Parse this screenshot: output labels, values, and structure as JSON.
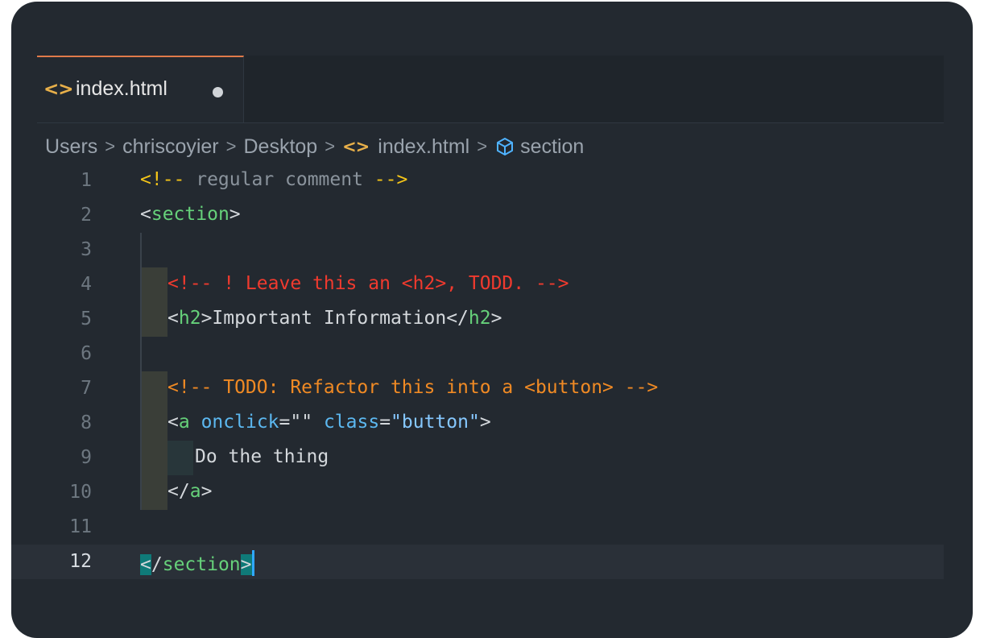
{
  "tab": {
    "icon": "html-brackets-icon",
    "label": "index.html",
    "modified": true
  },
  "breadcrumb": {
    "items": [
      "Users",
      "chriscoyier",
      "Desktop",
      "index.html",
      "section"
    ]
  },
  "editor": {
    "current_line": 12,
    "lines": [
      {
        "num": "1"
      },
      {
        "num": "2"
      },
      {
        "num": "3"
      },
      {
        "num": "4"
      },
      {
        "num": "5"
      },
      {
        "num": "6"
      },
      {
        "num": "7"
      },
      {
        "num": "8"
      },
      {
        "num": "9"
      },
      {
        "num": "10"
      },
      {
        "num": "11"
      },
      {
        "num": "12"
      }
    ],
    "tokens": {
      "l1_open": "<!--",
      "l1_text": " regular comment ",
      "l1_close": "-->",
      "l2_lt": "<",
      "l2_tag": "section",
      "l2_gt": ">",
      "l4_text": "<!-- ! Leave this an <h2>, TODD. -->",
      "l5_lt": "<",
      "l5_tag": "h2",
      "l5_mid": ">Important Information</",
      "l5_tag2": "h2",
      "l5_gt": ">",
      "l7_text": "<!-- TODO: Refactor this into a <button> -->",
      "l8_lt": "<",
      "l8_tag": "a",
      "l8_attr1": "onclick",
      "l8_eq1": "=",
      "l8_val1": "\"\"",
      "l8_attr2": "class",
      "l8_eq2": "=",
      "l8_val2": "\"button\"",
      "l8_gt": ">",
      "l9_text": "Do the thing",
      "l10_lt": "</",
      "l10_tag": "a",
      "l10_gt": ">",
      "l12_lt": "<",
      "l12_slash": "/",
      "l12_tag": "section",
      "l12_gt": ">"
    }
  },
  "colors": {
    "background": "#232930",
    "tab_accent": "#e07a4a",
    "tag": "#66d17a",
    "attribute": "#5cb8f0",
    "comment_delimiter": "#f5c518",
    "comment_alert": "#f03a2e",
    "comment_todo": "#f08a24",
    "cursor": "#2fa8ff"
  }
}
